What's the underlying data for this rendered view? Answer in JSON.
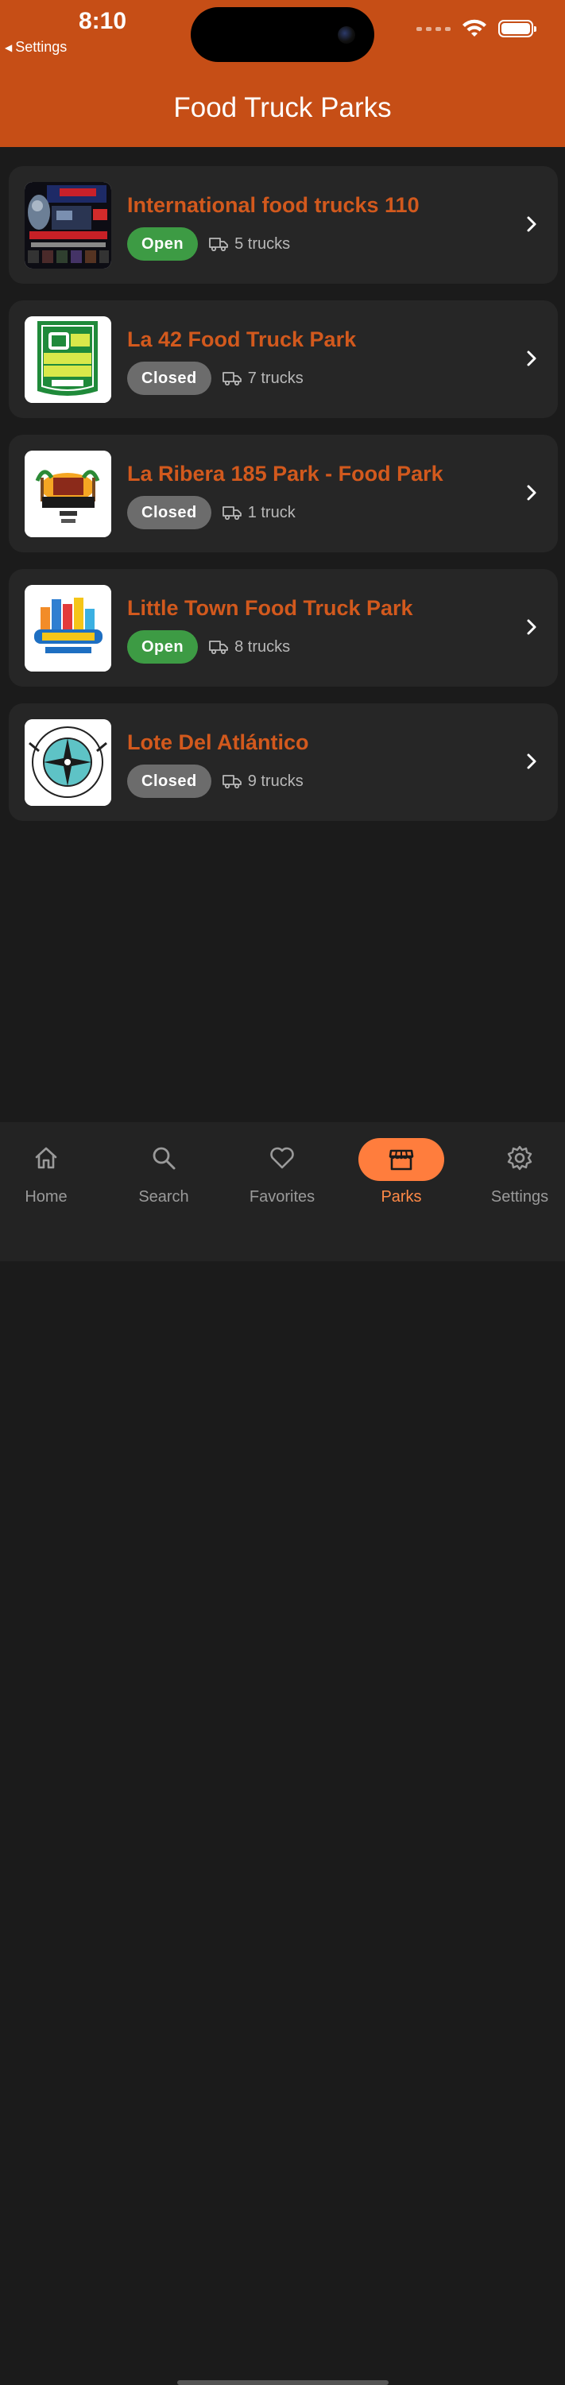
{
  "status_bar": {
    "time": "8:10",
    "back_label": "Settings"
  },
  "header": {
    "title": "Food Truck Parks",
    "background": "#c64e16"
  },
  "parks": [
    {
      "name": "International food trucks 110",
      "status": "Open",
      "trucks": "5 trucks",
      "logo": "flyer-poster"
    },
    {
      "name": "La 42 Food Truck Park",
      "status": "Closed",
      "trucks": "7 trucks",
      "logo": "la42-logo"
    },
    {
      "name": "La Ribera 185 Park - Food Park",
      "status": "Closed",
      "trucks": "1 truck",
      "logo": "la-ribera-logo"
    },
    {
      "name": "Little Town Food Truck Park",
      "status": "Open",
      "trucks": "8 trucks",
      "logo": "little-town-logo"
    },
    {
      "name": "Lote Del Atlántico",
      "status": "Closed",
      "trucks": "9 trucks",
      "logo": "lote-atlantico-logo"
    }
  ],
  "tabs": [
    {
      "label": "Home",
      "icon": "home-icon"
    },
    {
      "label": "Search",
      "icon": "search-icon"
    },
    {
      "label": "Favorites",
      "icon": "heart-icon"
    },
    {
      "label": "Parks",
      "icon": "storefront-icon",
      "active": true
    },
    {
      "label": "Settings",
      "icon": "gear-icon"
    }
  ],
  "colors": {
    "accent": "#d2591d",
    "open": "#3d9b44",
    "closed": "#6c6c6c",
    "active_tab": "#ff7d3d"
  }
}
